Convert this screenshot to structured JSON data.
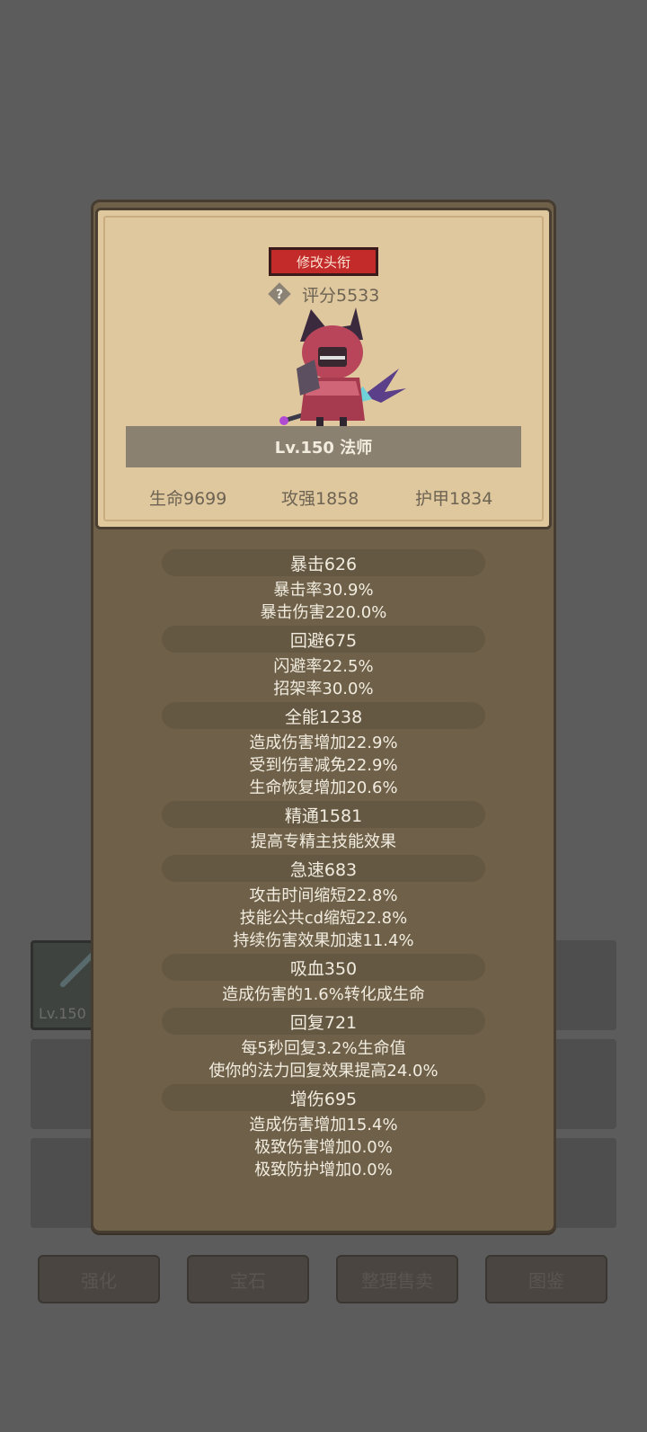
{
  "title_button": "修改头衔",
  "score_label": "评分5533",
  "level_label": "Lv.150 法师",
  "top_stats": [
    "生命9699",
    "攻强1858",
    "护甲1834"
  ],
  "groups": [
    {
      "header": "暴击626",
      "lines": [
        "暴击率30.9%",
        "暴击伤害220.0%"
      ]
    },
    {
      "header": "回避675",
      "lines": [
        "闪避率22.5%",
        "招架率30.0%"
      ]
    },
    {
      "header": "全能1238",
      "lines": [
        "造成伤害增加22.9%",
        "受到伤害减免22.9%",
        "生命恢复增加20.6%"
      ]
    },
    {
      "header": "精通1581",
      "lines": [
        "提高专精主技能效果"
      ]
    },
    {
      "header": "急速683",
      "lines": [
        "攻击时间缩短22.8%",
        "技能公共cd缩短22.8%",
        "持续伤害效果加速11.4%"
      ]
    },
    {
      "header": "吸血350",
      "lines": [
        "造成伤害的1.6%转化成生命"
      ]
    },
    {
      "header": "回复721",
      "lines": [
        "每5秒回复3.2%生命值",
        "使你的法力回复效果提高24.0%"
      ]
    },
    {
      "header": "增伤695",
      "lines": [
        "造成伤害增加15.4%",
        "极致伤害增加0.0%",
        "极致防护增加0.0%"
      ]
    }
  ],
  "inventory": {
    "item_level": "Lv.150"
  },
  "bottom_buttons": [
    "强化",
    "宝石",
    "整理售卖",
    "图鉴"
  ],
  "colors": {
    "title_button": "#c32b2b",
    "panel": "#6f6149",
    "card": "#e0c89e"
  },
  "icons": {
    "help": "question-diamond-icon",
    "character": "mage-character-sprite"
  }
}
